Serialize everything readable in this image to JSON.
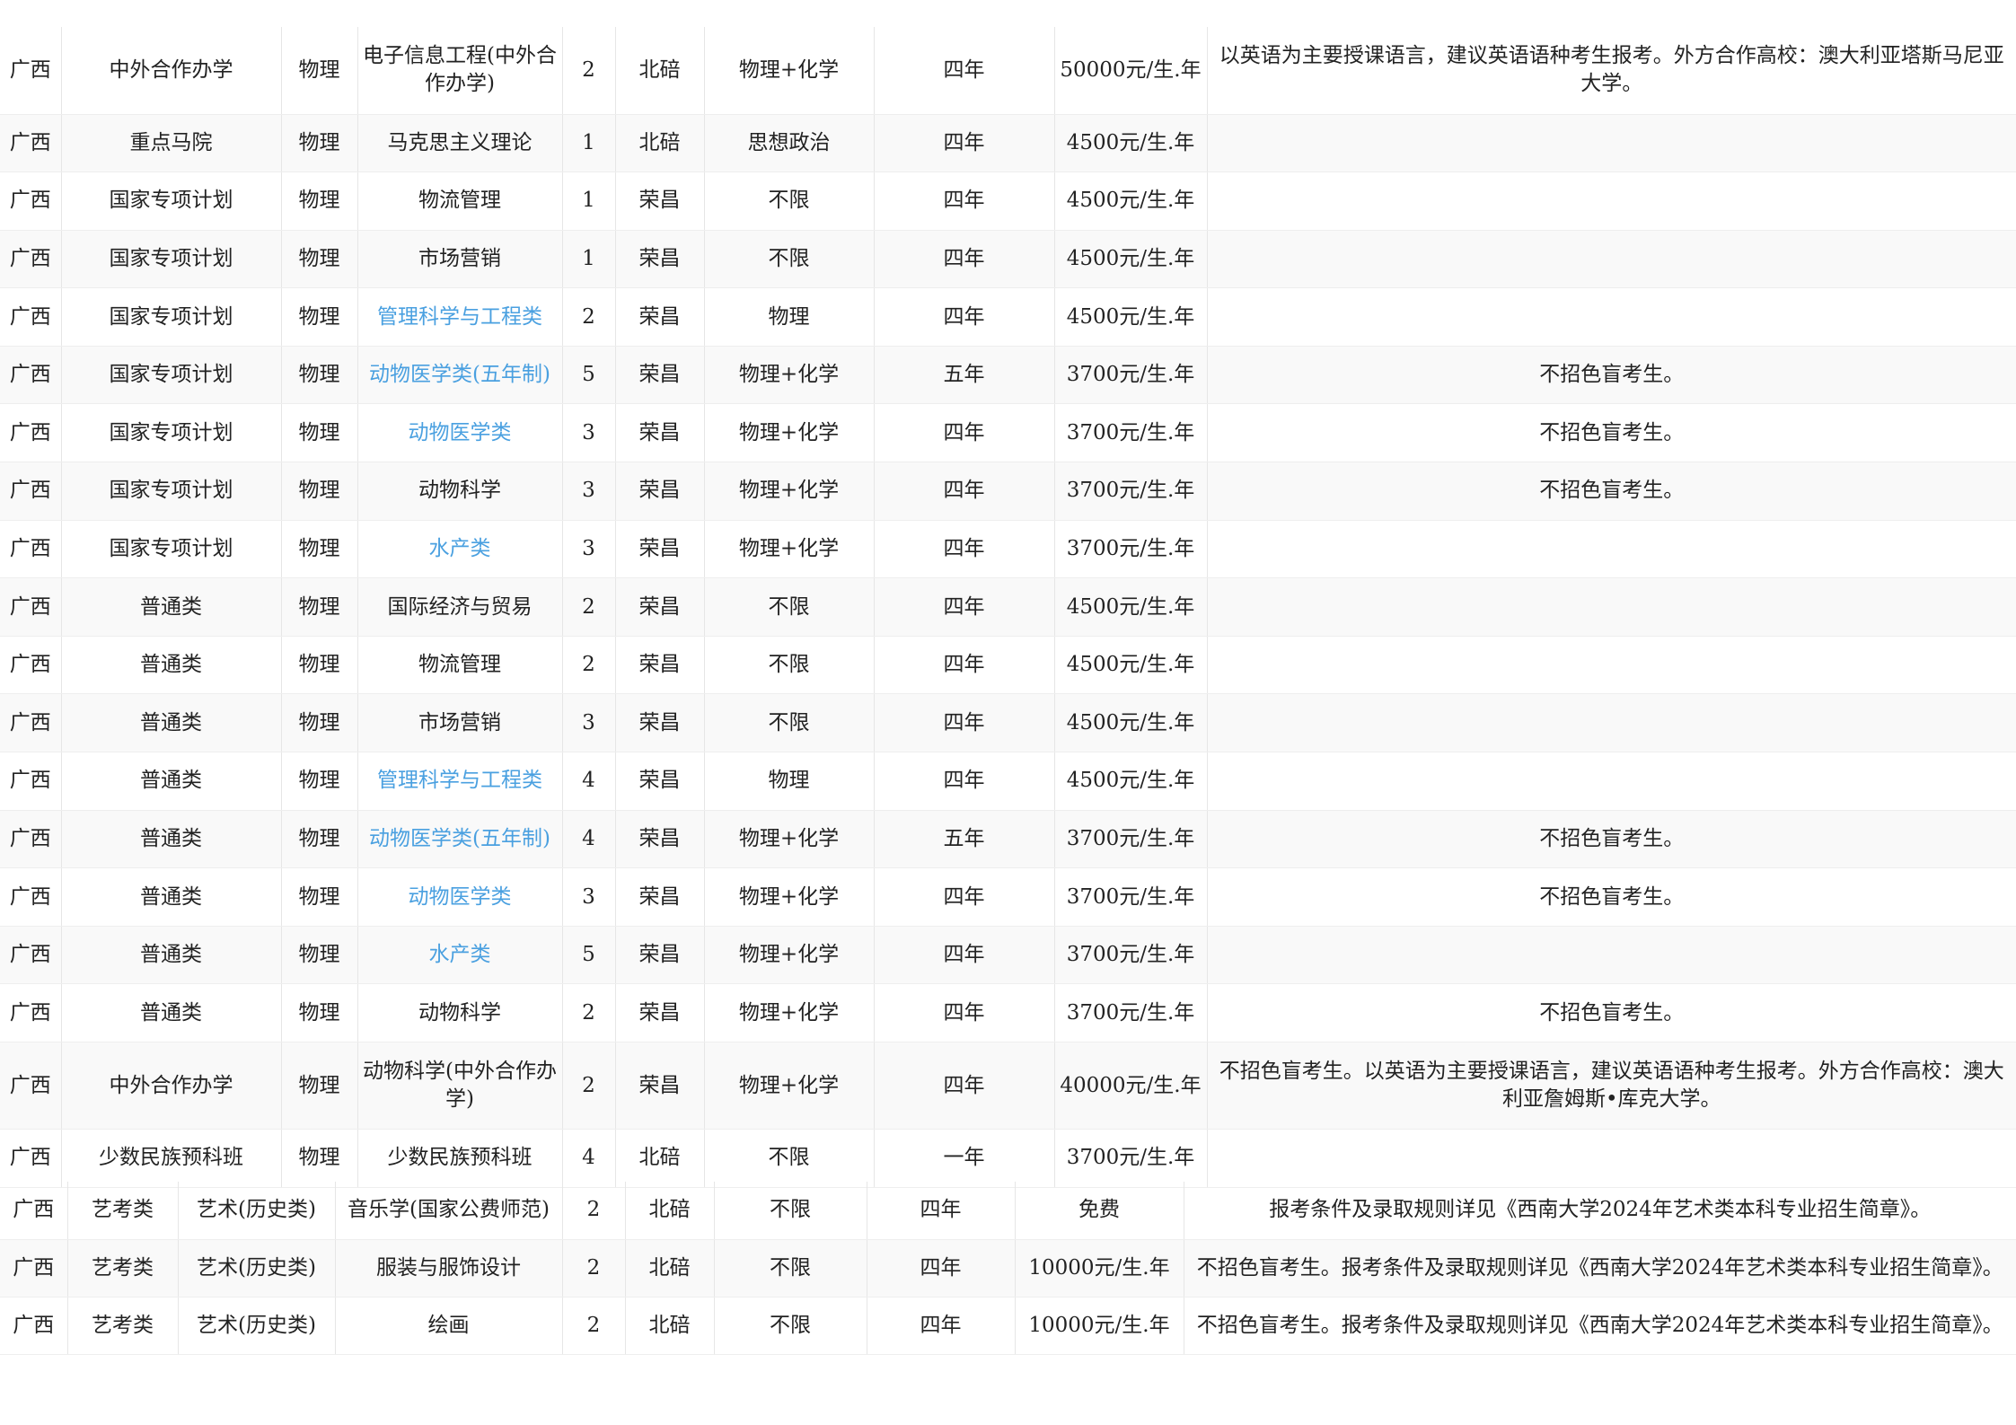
{
  "table1": {
    "rows": [
      [
        "广西",
        "中外合作办学",
        "物理",
        "电子信息工程(中外合作办学)",
        "2",
        "北碚",
        "物理+化学",
        "四年",
        "50000元/生.年",
        "以英语为主要授课语言，建议英语语种考生报考。外方合作高校：澳大利亚塔斯马尼亚大学。"
      ],
      [
        "广西",
        "重点马院",
        "物理",
        "马克思主义理论",
        "1",
        "北碚",
        "思想政治",
        "四年",
        "4500元/生.年",
        ""
      ],
      [
        "广西",
        "国家专项计划",
        "物理",
        "物流管理",
        "1",
        "荣昌",
        "不限",
        "四年",
        "4500元/生.年",
        ""
      ],
      [
        "广西",
        "国家专项计划",
        "物理",
        "市场营销",
        "1",
        "荣昌",
        "不限",
        "四年",
        "4500元/生.年",
        ""
      ],
      [
        "广西",
        "国家专项计划",
        "物理",
        "管理科学与工程类",
        "2",
        "荣昌",
        "物理",
        "四年",
        "4500元/生.年",
        ""
      ],
      [
        "广西",
        "国家专项计划",
        "物理",
        "动物医学类(五年制)",
        "5",
        "荣昌",
        "物理+化学",
        "五年",
        "3700元/生.年",
        "不招色盲考生。"
      ],
      [
        "广西",
        "国家专项计划",
        "物理",
        "动物医学类",
        "3",
        "荣昌",
        "物理+化学",
        "四年",
        "3700元/生.年",
        "不招色盲考生。"
      ],
      [
        "广西",
        "国家专项计划",
        "物理",
        "动物科学",
        "3",
        "荣昌",
        "物理+化学",
        "四年",
        "3700元/生.年",
        "不招色盲考生。"
      ],
      [
        "广西",
        "国家专项计划",
        "物理",
        "水产类",
        "3",
        "荣昌",
        "物理+化学",
        "四年",
        "3700元/生.年",
        ""
      ],
      [
        "广西",
        "普通类",
        "物理",
        "国际经济与贸易",
        "2",
        "荣昌",
        "不限",
        "四年",
        "4500元/生.年",
        ""
      ],
      [
        "广西",
        "普通类",
        "物理",
        "物流管理",
        "2",
        "荣昌",
        "不限",
        "四年",
        "4500元/生.年",
        ""
      ],
      [
        "广西",
        "普通类",
        "物理",
        "市场营销",
        "3",
        "荣昌",
        "不限",
        "四年",
        "4500元/生.年",
        ""
      ],
      [
        "广西",
        "普通类",
        "物理",
        "管理科学与工程类",
        "4",
        "荣昌",
        "物理",
        "四年",
        "4500元/生.年",
        ""
      ],
      [
        "广西",
        "普通类",
        "物理",
        "动物医学类(五年制)",
        "4",
        "荣昌",
        "物理+化学",
        "五年",
        "3700元/生.年",
        "不招色盲考生。"
      ],
      [
        "广西",
        "普通类",
        "物理",
        "动物医学类",
        "3",
        "荣昌",
        "物理+化学",
        "四年",
        "3700元/生.年",
        "不招色盲考生。"
      ],
      [
        "广西",
        "普通类",
        "物理",
        "水产类",
        "5",
        "荣昌",
        "物理+化学",
        "四年",
        "3700元/生.年",
        ""
      ],
      [
        "广西",
        "普通类",
        "物理",
        "动物科学",
        "2",
        "荣昌",
        "物理+化学",
        "四年",
        "3700元/生.年",
        "不招色盲考生。"
      ],
      [
        "广西",
        "中外合作办学",
        "物理",
        "动物科学(中外合作办学)",
        "2",
        "荣昌",
        "物理+化学",
        "四年",
        "40000元/生.年",
        "不招色盲考生。以英语为主要授课语言，建议英语语种考生报考。外方合作高校：澳大利亚詹姆斯•库克大学。"
      ],
      [
        "广西",
        "少数民族预科班",
        "物理",
        "少数民族预科班",
        "4",
        "北碚",
        "不限",
        "一年",
        "3700元/生.年",
        ""
      ]
    ],
    "tall_rows": [
      0,
      17
    ],
    "link_majors": [
      "管理科学与工程类",
      "动物医学类(五年制)",
      "动物医学类",
      "水产类"
    ]
  },
  "table2": {
    "rows": [
      [
        "广西",
        "艺考类",
        "艺术(历史类)",
        "音乐学(国家公费师范)",
        "2",
        "北碚",
        "不限",
        "四年",
        "免费",
        "报考条件及录取规则详见《西南大学2024年艺术类本科专业招生简章》。"
      ],
      [
        "广西",
        "艺考类",
        "艺术(历史类)",
        "服装与服饰设计",
        "2",
        "北碚",
        "不限",
        "四年",
        "10000元/生.年",
        "不招色盲考生。报考条件及录取规则详见《西南大学2024年艺术类本科专业招生简章》。"
      ],
      [
        "广西",
        "艺考类",
        "艺术(历史类)",
        "绘画",
        "2",
        "北碚",
        "不限",
        "四年",
        "10000元/生.年",
        "不招色盲考生。报考条件及录取规则详见《西南大学2024年艺术类本科专业招生简章》。"
      ]
    ]
  }
}
